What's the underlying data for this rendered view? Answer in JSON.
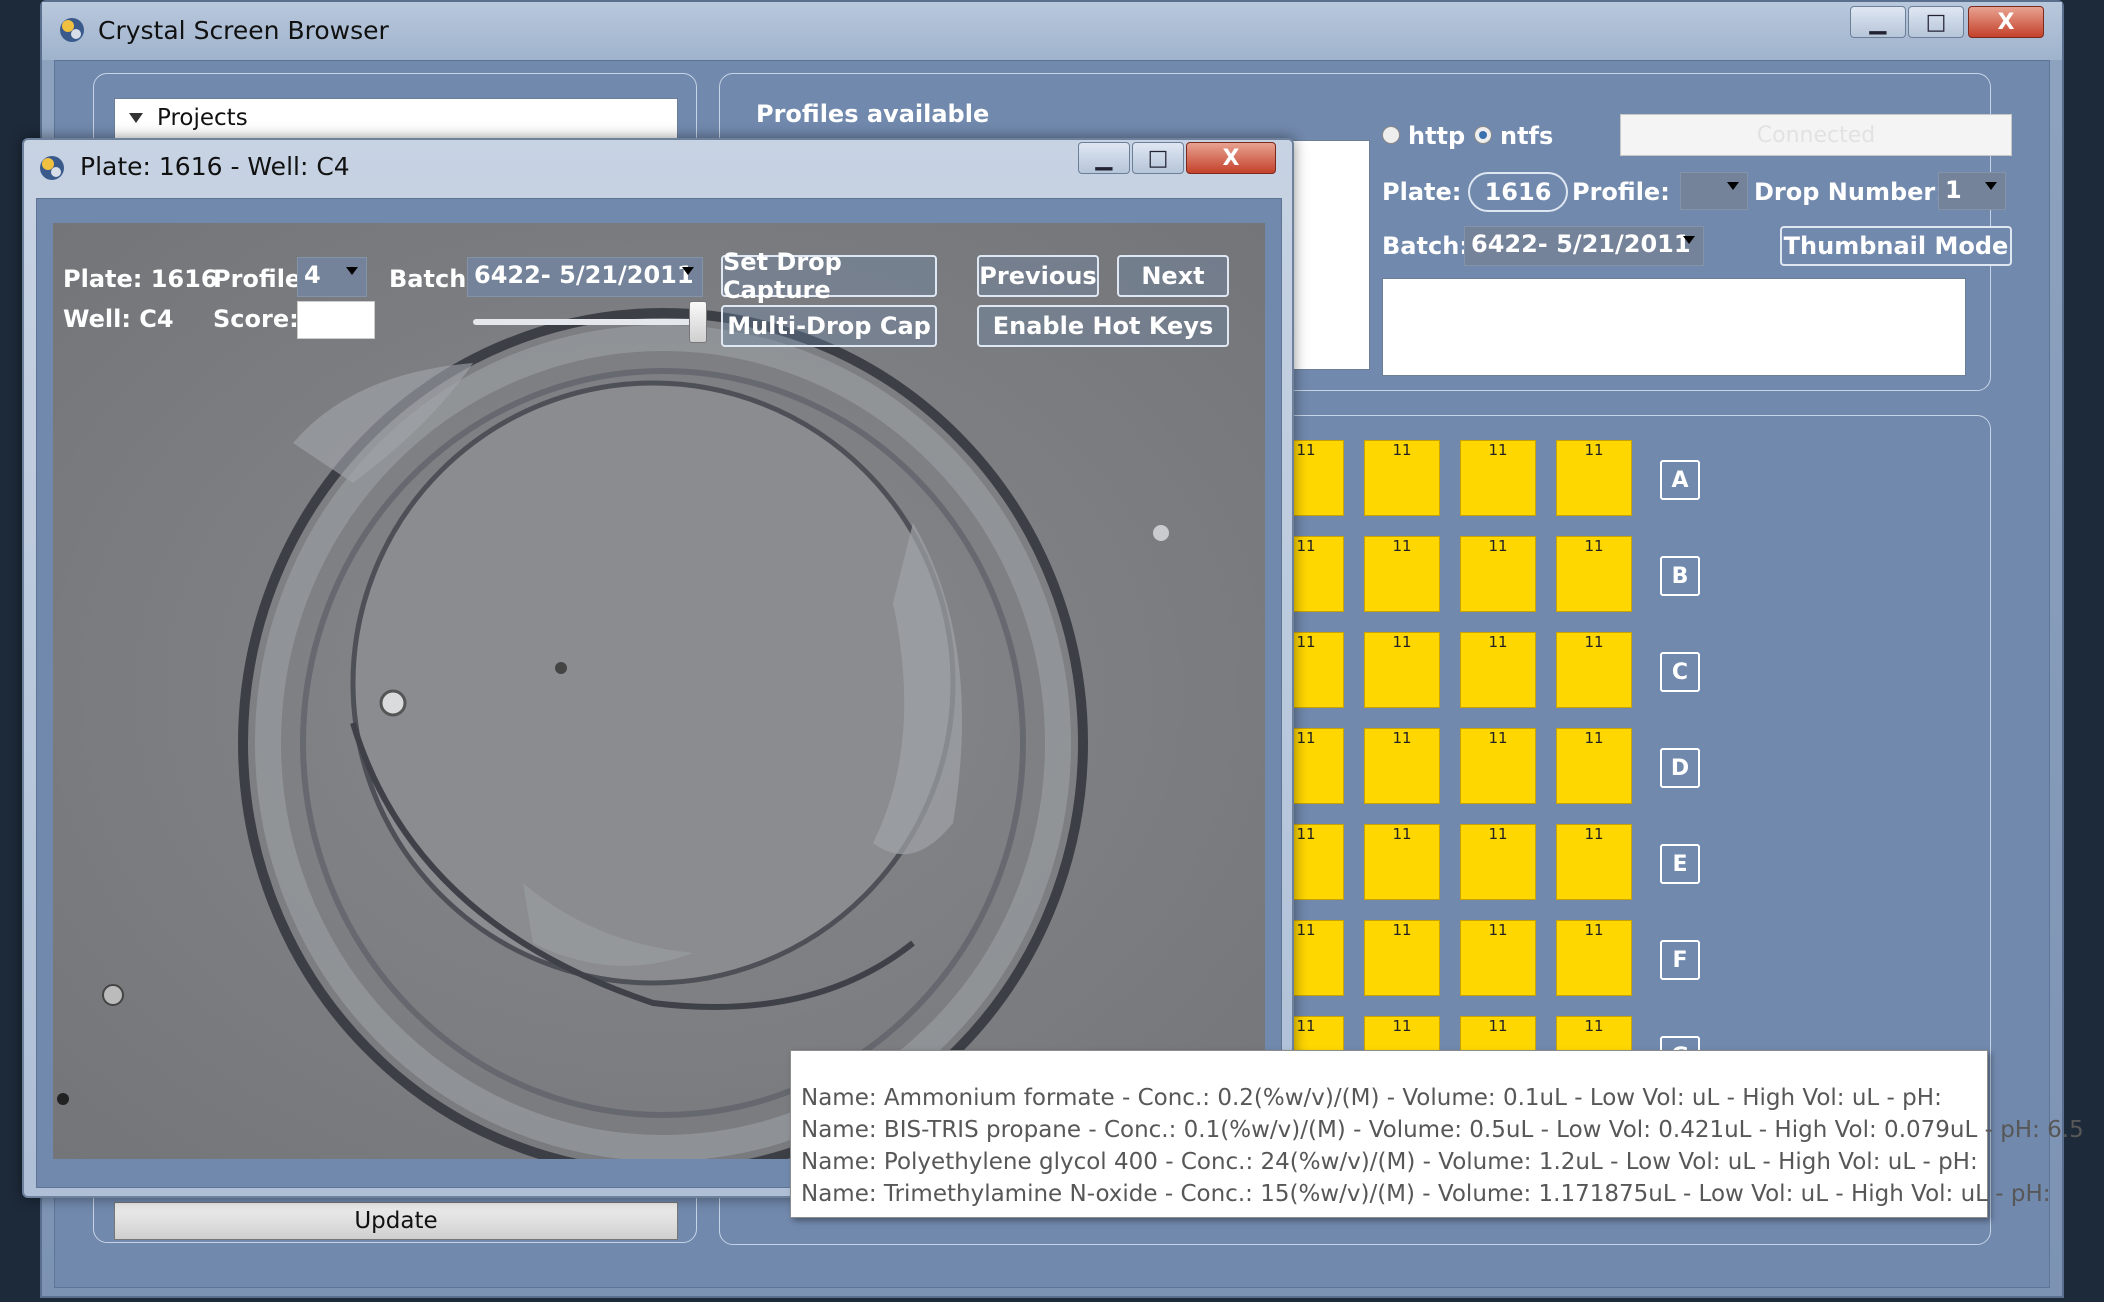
{
  "main_window": {
    "title": "Crystal Screen Browser",
    "controls": {
      "minimize": "▁",
      "maximize": "□",
      "close": "X"
    }
  },
  "projects": {
    "header": "Projects",
    "update_label": "Update"
  },
  "profiles": {
    "title": "Profiles available"
  },
  "connection": {
    "http_label": "http",
    "ntfs_label": "ntfs",
    "selected": "ntfs",
    "status": "Connected"
  },
  "plate_controls": {
    "plate_label": "Plate:",
    "plate_value": "1616",
    "profile_label": "Profile:",
    "profile_value": "",
    "drop_number_label": "Drop Number:",
    "drop_number_value": "1",
    "batch_label": "Batch:",
    "batch_value": "6422- 5/21/2011",
    "thumbnail_mode_label": "Thumbnail Mode"
  },
  "grid": {
    "cell_text": "11",
    "rows": [
      "A",
      "B",
      "C",
      "D",
      "E",
      "F",
      "G"
    ],
    "colors": {
      "well": "#ffd700"
    }
  },
  "well_window": {
    "title": "Plate: 1616 - Well: C4",
    "controls": {
      "minimize": "▁",
      "maximize": "□",
      "close": "X"
    },
    "plate_text": "Plate: 1616",
    "well_text": "Well:  C4",
    "profile_label": "Profile:",
    "profile_value": "4",
    "score_label": "Score:",
    "score_value": "",
    "batch_label": "Batch:",
    "batch_value": "6422- 5/21/2011",
    "set_drop_capture_label": "Set Drop Capture",
    "multi_drop_capture_label": "Multi-Drop Cap",
    "previous_label": "Previous",
    "next_label": "Next",
    "enable_hot_keys_label": "Enable Hot Keys",
    "slider_value": 1.0
  },
  "tooltip": {
    "lines": [
      "Name: Ammonium formate - Conc.: 0.2(%w/v)/(M) - Volume: 0.1uL - Low Vol: uL - High Vol: uL - pH:",
      "Name: BIS-TRIS propane - Conc.: 0.1(%w/v)/(M) - Volume: 0.5uL - Low Vol: 0.421uL - High Vol: 0.079uL - pH: 6.5",
      "Name: Polyethylene glycol 400 - Conc.: 24(%w/v)/(M) - Volume: 1.2uL - Low Vol: uL - High Vol: uL - pH:",
      "Name: Trimethylamine N-oxide  - Conc.: 15(%w/v)/(M) - Volume: 1.171875uL - Low Vol: uL - High Vol: uL - pH:"
    ]
  }
}
